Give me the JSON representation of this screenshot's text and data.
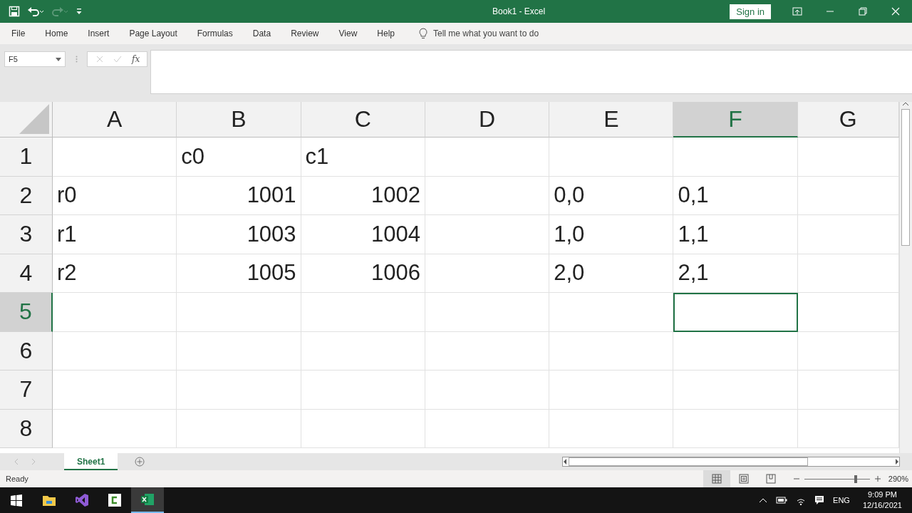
{
  "window": {
    "title": "Book1 - Excel",
    "sign_in": "Sign in",
    "redo_disabled": true
  },
  "ribbon": {
    "tabs": [
      {
        "label": "File"
      },
      {
        "label": "Home"
      },
      {
        "label": "Insert"
      },
      {
        "label": "Page Layout"
      },
      {
        "label": "Formulas"
      },
      {
        "label": "Data"
      },
      {
        "label": "Review"
      },
      {
        "label": "View"
      },
      {
        "label": "Help"
      }
    ],
    "tell_me": "Tell me what you want to do"
  },
  "formula_bar": {
    "name_box": "F5",
    "function_label": "fx"
  },
  "grid": {
    "columns": [
      {
        "label": "A",
        "selected": false
      },
      {
        "label": "B",
        "selected": false
      },
      {
        "label": "C",
        "selected": false
      },
      {
        "label": "D",
        "selected": false
      },
      {
        "label": "E",
        "selected": false
      },
      {
        "label": "F",
        "selected": true
      },
      {
        "label": "G",
        "selected": false
      }
    ],
    "rows": [
      {
        "header": "1",
        "selected": false,
        "cells": [
          {
            "kind": "blank",
            "selected": false
          },
          {
            "kind": "text",
            "text": "c0",
            "selected": false
          },
          {
            "kind": "text",
            "text": "c1",
            "selected": false
          },
          {
            "kind": "blank",
            "selected": false
          },
          {
            "kind": "blank",
            "selected": false
          },
          {
            "kind": "blank",
            "selected": false
          },
          {
            "kind": "blank",
            "selected": false
          }
        ]
      },
      {
        "header": "2",
        "selected": false,
        "cells": [
          {
            "kind": "text",
            "text": "r0",
            "selected": false
          },
          {
            "kind": "number",
            "text": "1001",
            "selected": false
          },
          {
            "kind": "number",
            "text": "1002",
            "selected": false
          },
          {
            "kind": "blank",
            "selected": false
          },
          {
            "kind": "text",
            "text": "0,0",
            "selected": false
          },
          {
            "kind": "text",
            "text": "0,1",
            "selected": false
          },
          {
            "kind": "blank",
            "selected": false
          }
        ]
      },
      {
        "header": "3",
        "selected": false,
        "cells": [
          {
            "kind": "text",
            "text": "r1",
            "selected": false
          },
          {
            "kind": "number",
            "text": "1003",
            "selected": false
          },
          {
            "kind": "number",
            "text": "1004",
            "selected": false
          },
          {
            "kind": "blank",
            "selected": false
          },
          {
            "kind": "text",
            "text": "1,0",
            "selected": false
          },
          {
            "kind": "text",
            "text": "1,1",
            "selected": false
          },
          {
            "kind": "blank",
            "selected": false
          }
        ]
      },
      {
        "header": "4",
        "selected": false,
        "cells": [
          {
            "kind": "text",
            "text": "r2",
            "selected": false
          },
          {
            "kind": "number",
            "text": "1005",
            "selected": false
          },
          {
            "kind": "number",
            "text": "1006",
            "selected": false
          },
          {
            "kind": "blank",
            "selected": false
          },
          {
            "kind": "text",
            "text": "2,0",
            "selected": false
          },
          {
            "kind": "text",
            "text": "2,1",
            "selected": false
          },
          {
            "kind": "blank",
            "selected": false
          }
        ]
      },
      {
        "header": "5",
        "selected": true,
        "cells": [
          {
            "kind": "blank",
            "selected": false
          },
          {
            "kind": "blank",
            "selected": false
          },
          {
            "kind": "blank",
            "selected": false
          },
          {
            "kind": "blank",
            "selected": false
          },
          {
            "kind": "blank",
            "selected": false
          },
          {
            "kind": "blank",
            "selected": true
          },
          {
            "kind": "blank",
            "selected": false
          }
        ]
      },
      {
        "header": "6",
        "selected": false,
        "cells": [
          {
            "kind": "blank",
            "selected": false
          },
          {
            "kind": "blank",
            "selected": false
          },
          {
            "kind": "blank",
            "selected": false
          },
          {
            "kind": "blank",
            "selected": false
          },
          {
            "kind": "blank",
            "selected": false
          },
          {
            "kind": "blank",
            "selected": false
          },
          {
            "kind": "blank",
            "selected": false
          }
        ]
      },
      {
        "header": "7",
        "selected": false,
        "cells": [
          {
            "kind": "blank",
            "selected": false
          },
          {
            "kind": "blank",
            "selected": false
          },
          {
            "kind": "blank",
            "selected": false
          },
          {
            "kind": "blank",
            "selected": false
          },
          {
            "kind": "blank",
            "selected": false
          },
          {
            "kind": "blank",
            "selected": false
          },
          {
            "kind": "blank",
            "selected": false
          }
        ]
      },
      {
        "header": "8",
        "selected": false,
        "cells": [
          {
            "kind": "blank",
            "selected": false
          },
          {
            "kind": "blank",
            "selected": false
          },
          {
            "kind": "blank",
            "selected": false
          },
          {
            "kind": "blank",
            "selected": false
          },
          {
            "kind": "blank",
            "selected": false
          },
          {
            "kind": "blank",
            "selected": false
          },
          {
            "kind": "blank",
            "selected": false
          }
        ]
      }
    ]
  },
  "sheets": [
    {
      "label": "Sheet1",
      "selected": true
    }
  ],
  "status_bar": {
    "status": "Ready",
    "views": [
      {
        "kind": "normal",
        "selected": true
      },
      {
        "kind": "page_layout",
        "selected": false
      },
      {
        "kind": "page_break",
        "selected": false
      }
    ],
    "zoom": {
      "level": 0.78,
      "reading": "290%"
    }
  },
  "taskbar": {
    "apps": [
      {
        "kind": "start",
        "selected": false
      },
      {
        "kind": "explorer",
        "selected": false
      },
      {
        "kind": "visual_studio",
        "selected": false
      },
      {
        "kind": "camtasia",
        "selected": false
      },
      {
        "kind": "excel",
        "selected": true
      }
    ],
    "language": "ENG",
    "time": "9:09 PM",
    "date": "12/16/2021"
  }
}
